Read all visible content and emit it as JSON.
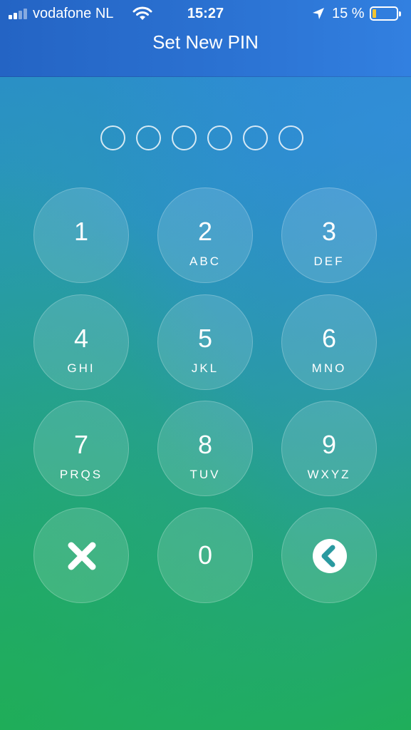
{
  "status_bar": {
    "carrier": "vodafone NL",
    "time": "15:27",
    "battery_percent": "15 %",
    "battery_level": 0.15,
    "battery_color": "#f3c42f"
  },
  "header": {
    "title": "Set New PIN"
  },
  "pin": {
    "length": 6,
    "entered": 0
  },
  "keypad": {
    "keys": [
      {
        "digit": "1",
        "letters": ""
      },
      {
        "digit": "2",
        "letters": "ABC"
      },
      {
        "digit": "3",
        "letters": "DEF"
      },
      {
        "digit": "4",
        "letters": "GHI"
      },
      {
        "digit": "5",
        "letters": "JKL"
      },
      {
        "digit": "6",
        "letters": "MNO"
      },
      {
        "digit": "7",
        "letters": "PRQS"
      },
      {
        "digit": "8",
        "letters": "TUV"
      },
      {
        "digit": "9",
        "letters": "WXYZ"
      }
    ],
    "cancel_icon": "close-icon",
    "zero": "0",
    "back_icon": "chevron-left-icon"
  },
  "colors": {
    "header_bg": "#2b72d2",
    "text": "#ffffff"
  }
}
